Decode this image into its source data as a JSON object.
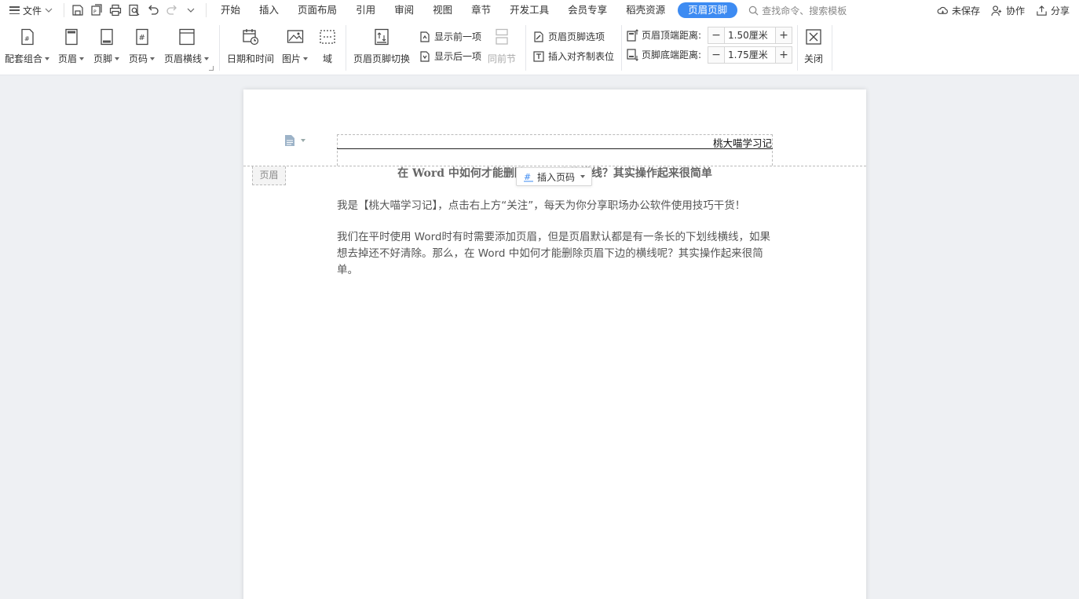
{
  "menubar": {
    "file_label": "文件",
    "tabs": [
      "开始",
      "插入",
      "页面布局",
      "引用",
      "审阅",
      "视图",
      "章节",
      "开发工具",
      "会员专享",
      "稻壳资源"
    ],
    "active_tab": "页眉页脚",
    "search_placeholder": "查找命令、搜索模板",
    "unsaved": "未保存",
    "collab": "协作",
    "share": "分享"
  },
  "ribbon": {
    "set_combo": "配套组合",
    "header": "页眉",
    "footer": "页脚",
    "page_number": "页码",
    "header_line": "页眉横线",
    "date_time": "日期和时间",
    "picture": "图片",
    "field": "域",
    "switch_header_footer": "页眉页脚切换",
    "show_prev": "显示前一项",
    "show_next": "显示后一项",
    "same_as_prev": "同前节",
    "hf_options": "页眉页脚选项",
    "insert_align_tab": "插入对齐制表位",
    "header_top_label": "页眉顶端距离:",
    "header_top_value": "1.50厘米",
    "footer_bottom_label": "页脚底端距离:",
    "footer_bottom_value": "1.75厘米",
    "close": "关闭"
  },
  "document": {
    "header_text": "桃大喵学习记",
    "header_tag": "页眉",
    "insert_page_number": "插入页码",
    "title": "在 Word 中如何才能删除页眉下边的横线？其实操作起来很简单",
    "para1": "我是【桃大喵学习记】，点击右上方“关注”，每天为你分享职场办公软件使用技巧干货！",
    "para2": "我们在平时使用 Word时有时需要添加页眉，但是页眉默认都是有一条长的下划线横线，如果想去掉还不好清除。那么，在 Word 中如何才能删除页眉下边的横线呢？其实操作起来很简单。"
  },
  "colors": {
    "accent": "#3d8bf2",
    "background": "#eef0f3"
  }
}
